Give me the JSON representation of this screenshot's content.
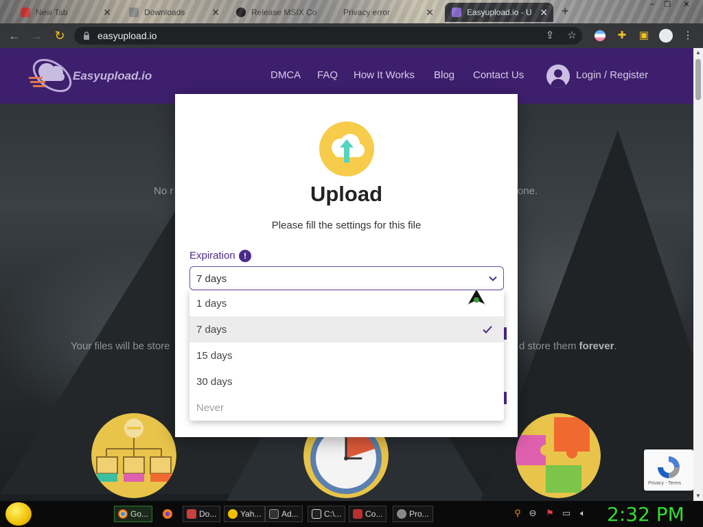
{
  "browser": {
    "tabs": [
      {
        "title": "New Tab"
      },
      {
        "title": "Downloads"
      },
      {
        "title": "Release MSIX Co"
      },
      {
        "title": "Privacy error"
      },
      {
        "title": "Easyupload.io - U"
      }
    ],
    "url": "easyupload.io"
  },
  "site": {
    "logo_text": "Easyupload.io",
    "nav": [
      "DMCA",
      "FAQ",
      "How It Works",
      "Blog",
      "Contact Us"
    ],
    "login_label": "Login / Register",
    "bg_line1_left": "No r",
    "bg_line1_right": "one.",
    "bg_line2_left": "Your files will be store",
    "bg_line2_right_prefix": "d store them ",
    "bg_line2_right_bold": "forever",
    "bg_line2_right_suffix": "."
  },
  "modal": {
    "title": "Upload",
    "subtitle": "Please fill the settings for this file",
    "expiration_label": "Expiration",
    "info_glyph": "!",
    "selected_value": "7 days",
    "options": [
      {
        "label": "1 days",
        "state": "normal"
      },
      {
        "label": "7 days",
        "state": "selected"
      },
      {
        "label": "15 days",
        "state": "normal"
      },
      {
        "label": "30 days",
        "state": "normal"
      },
      {
        "label": "Never",
        "state": "disabled"
      }
    ]
  },
  "recaptcha": {
    "links": "Privacy - Terms"
  },
  "taskbar": {
    "buttons": [
      "Go...",
      "Do...",
      "Yah...",
      "Ad...",
      "C:\\...",
      "Co...",
      "Pro..."
    ],
    "clock": "2:32 PM"
  },
  "colors": {
    "header_purple": "#3e1f6e",
    "accent_purple": "#4b2a8a",
    "clock_green": "#33dd33"
  },
  "icons": [
    "upload-cloud-icon",
    "info-icon",
    "chevron-down-icon",
    "check-icon",
    "lock-icon",
    "user-avatar-icon",
    "cursor-icon"
  ]
}
